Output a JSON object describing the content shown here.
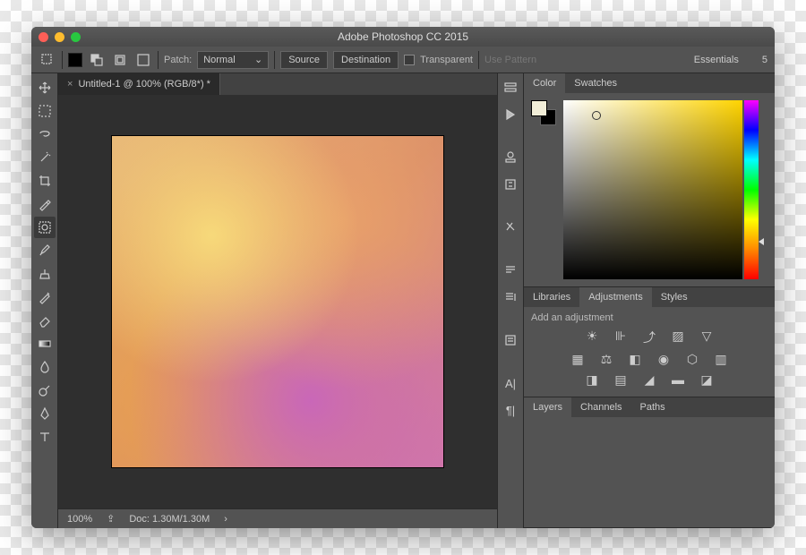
{
  "window": {
    "title": "Adobe Photoshop CC 2015"
  },
  "options": {
    "patch_label": "Patch:",
    "patch_mode": "Normal",
    "source": "Source",
    "destination": "Destination",
    "transparent": "Transparent",
    "use_pattern": "Use Pattern",
    "workspace": "Essentials",
    "count": "5"
  },
  "document": {
    "tab_title": "Untitled-1 @ 100% (RGB/8*) *",
    "zoom": "100%",
    "doc_info": "Doc: 1.30M/1.30M"
  },
  "panels": {
    "color_tab": "Color",
    "swatches_tab": "Swatches",
    "libraries_tab": "Libraries",
    "adjustments_tab": "Adjustments",
    "styles_tab": "Styles",
    "add_adjustment": "Add an adjustment",
    "layers_tab": "Layers",
    "channels_tab": "Channels",
    "paths_tab": "Paths"
  }
}
